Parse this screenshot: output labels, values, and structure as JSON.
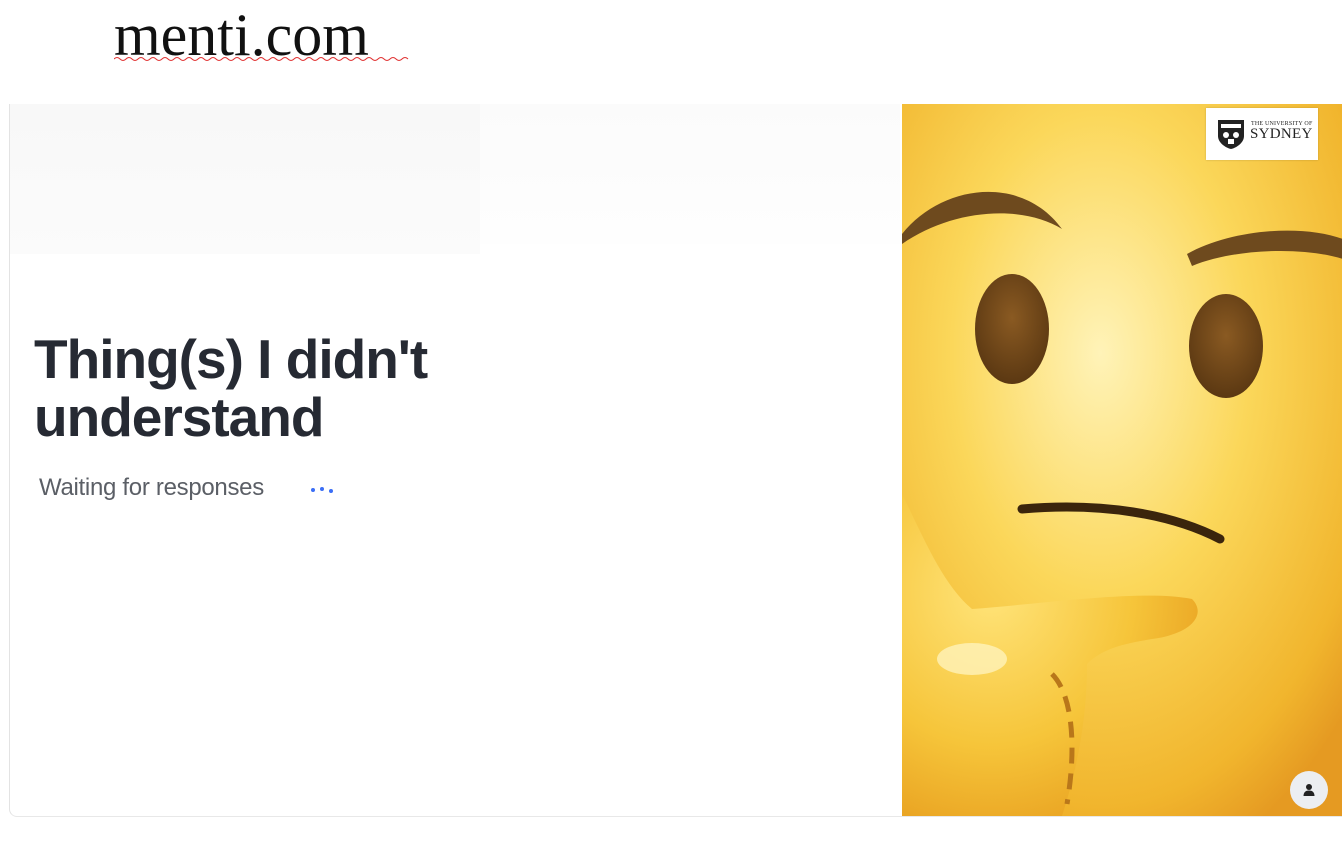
{
  "document": {
    "url_text": "menti.com"
  },
  "slide": {
    "question": "Thing(s) I didn't understand",
    "status": "Waiting for responses",
    "status_indicator_icon": "ellipsis-dots-icon",
    "image_icon": "thinking-face-emoji",
    "logo": {
      "small_text": "THE UNIVERSITY OF",
      "big_text": "SYDNEY",
      "icon": "university-crest-icon"
    },
    "participants_button_icon": "person-icon"
  },
  "colors": {
    "question_text": "#262a33",
    "status_text": "#5b5f66",
    "dots": "#3b6ef6",
    "emoji_yellow": "#f2c33c"
  }
}
